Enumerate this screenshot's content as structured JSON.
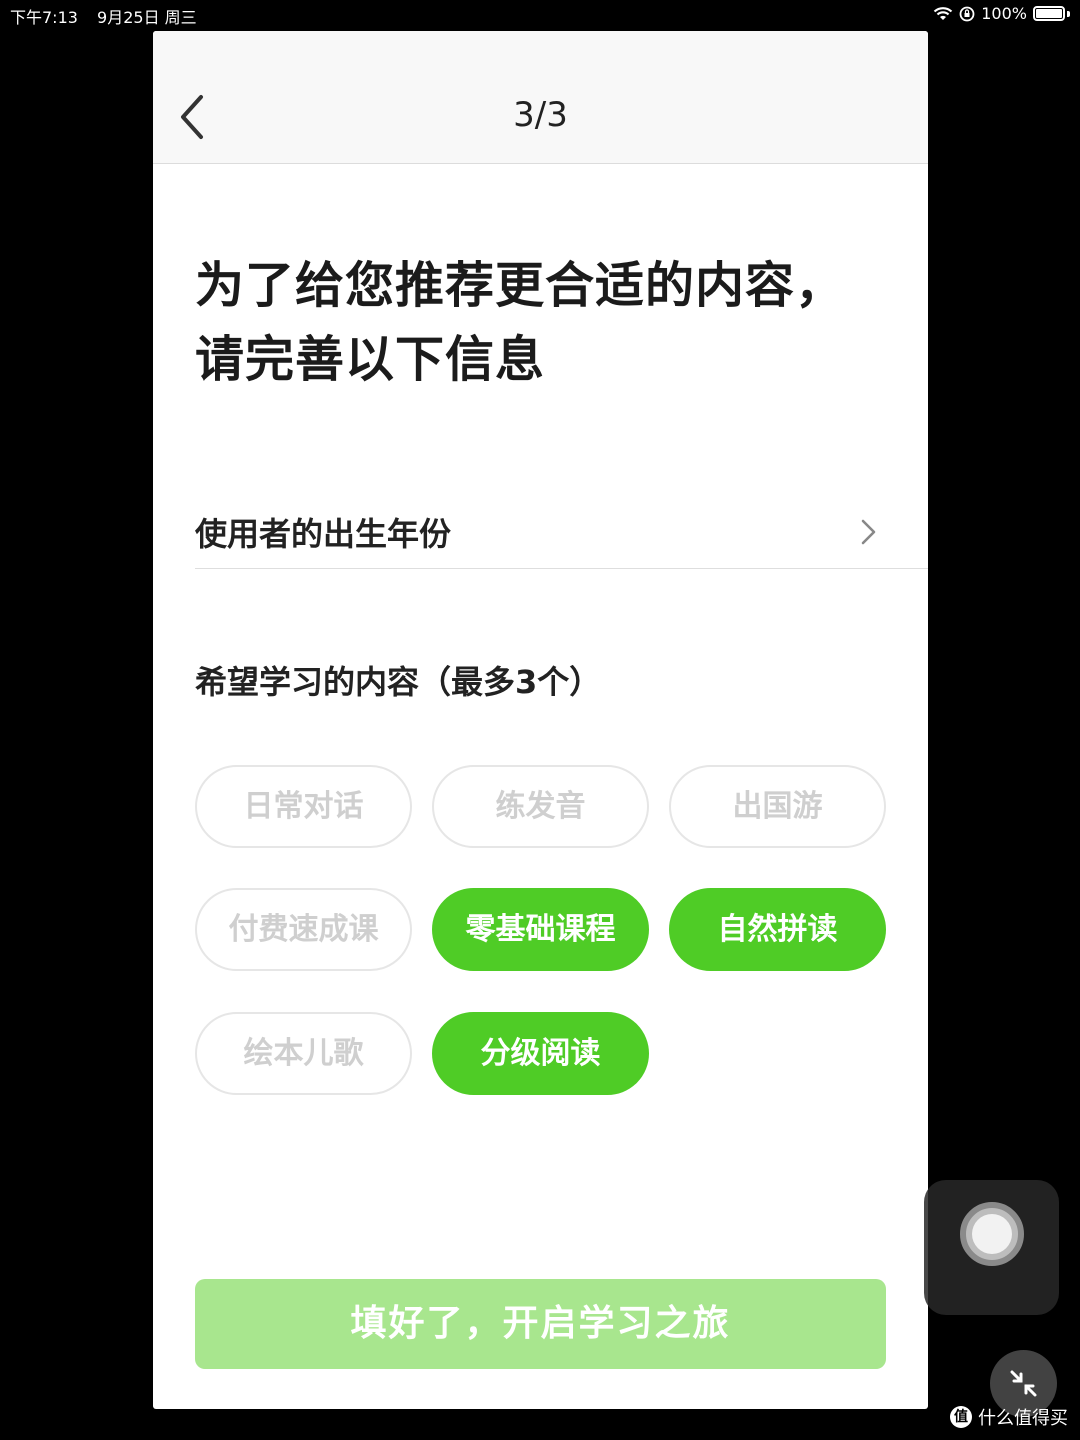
{
  "status_bar": {
    "time": "下午7:13",
    "date": "9月25日 周三",
    "battery": "100%"
  },
  "nav": {
    "title": "3/3"
  },
  "headline": {
    "line1": "为了给您推荐更合适的内容，",
    "line2": "请完善以下信息"
  },
  "birth_year": {
    "label": "使用者的出生年份"
  },
  "interests": {
    "title": "希望学习的内容（最多3个）",
    "options": [
      {
        "label": "日常对话",
        "selected": false
      },
      {
        "label": "练发音",
        "selected": false
      },
      {
        "label": "出国游",
        "selected": false
      },
      {
        "label": "付费速成课",
        "selected": false
      },
      {
        "label": "零基础课程",
        "selected": true
      },
      {
        "label": "自然拼读",
        "selected": true
      },
      {
        "label": "绘本儿歌",
        "selected": false
      },
      {
        "label": "分级阅读",
        "selected": true
      }
    ]
  },
  "submit": {
    "label": "填好了，开启学习之旅"
  },
  "watermark": {
    "text": "什么值得买",
    "icon_text": "值"
  },
  "colors": {
    "accent": "#4fcc26",
    "button_disabled": "#a8e68e"
  }
}
